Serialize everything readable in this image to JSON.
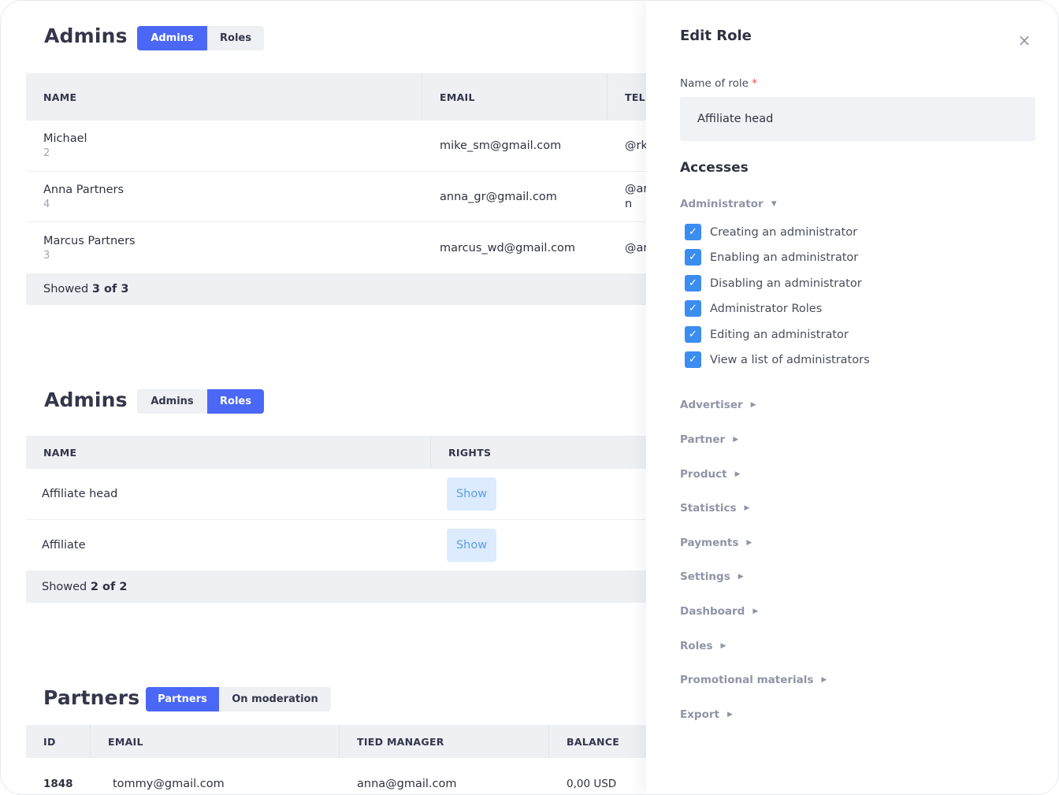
{
  "admins_section": {
    "title": "Admins",
    "tabs": [
      {
        "label": "Admins",
        "active": true
      },
      {
        "label": "Roles",
        "active": false
      }
    ],
    "columns": [
      "NAME",
      "EMAIL",
      "TELE"
    ],
    "rows": [
      {
        "name": "Michael",
        "count": "2",
        "email": "mike_sm@gmail.com",
        "tele": "@rk"
      },
      {
        "name": "Anna Partners",
        "count": "4",
        "email": "anna_gr@gmail.com",
        "tele": "@ar",
        "tele2": "n"
      },
      {
        "name": "Marcus Partners",
        "count": "3",
        "email": "marcus_wd@gmail.com",
        "tele": "@ar"
      }
    ],
    "footer_prefix": "Showed",
    "footer_count": "3 of 3"
  },
  "roles_section": {
    "title": "Admins",
    "tabs": [
      {
        "label": "Admins",
        "active": false
      },
      {
        "label": "Roles",
        "active": true
      }
    ],
    "columns": [
      "NAME",
      "RIGHTS"
    ],
    "rows": [
      {
        "name": "Affiliate head",
        "action": "Show"
      },
      {
        "name": "Affiliate",
        "action": "Show"
      }
    ],
    "footer_prefix": "Showed",
    "footer_count": "2 of 2"
  },
  "partners_section": {
    "title": "Partners",
    "tabs": [
      {
        "label": "Partners",
        "active": true
      },
      {
        "label": "On moderation",
        "active": false
      }
    ],
    "columns": [
      "ID",
      "EMAIL",
      "TIED MANAGER",
      "BALANCE"
    ],
    "rows": [
      {
        "id": "1848",
        "email": "tommy@gmail.com",
        "manager": "anna@gmail.com",
        "balance": "0,00 USD"
      }
    ]
  },
  "edit_panel": {
    "title": "Edit Role",
    "close_icon": "×",
    "name_label": "Name of role",
    "required_mark": "*",
    "name_value": "Affiliate head",
    "accesses_title": "Accesses",
    "administrator_group": {
      "label": "Administrator",
      "expanded": true,
      "items": [
        {
          "label": "Creating an administrator",
          "checked": true
        },
        {
          "label": "Enabling an administrator",
          "checked": true
        },
        {
          "label": "Disabling an administrator",
          "checked": true
        },
        {
          "label": "Administrator Roles",
          "checked": true
        },
        {
          "label": "Editing an administrator",
          "checked": true
        },
        {
          "label": "View a list of administrators",
          "checked": true
        }
      ]
    },
    "collapsed_groups": [
      "Advertiser",
      "Partner",
      "Product",
      "Statistics",
      "Payments",
      "Settings",
      "Dashboard",
      "Roles",
      "Promotional materials",
      "Export"
    ]
  },
  "colors": {
    "accent": "#4a68f5",
    "checkbox": "#3b8df0",
    "table_header_bg": "#eef0f4",
    "show_button_bg": "#dcebfd"
  }
}
